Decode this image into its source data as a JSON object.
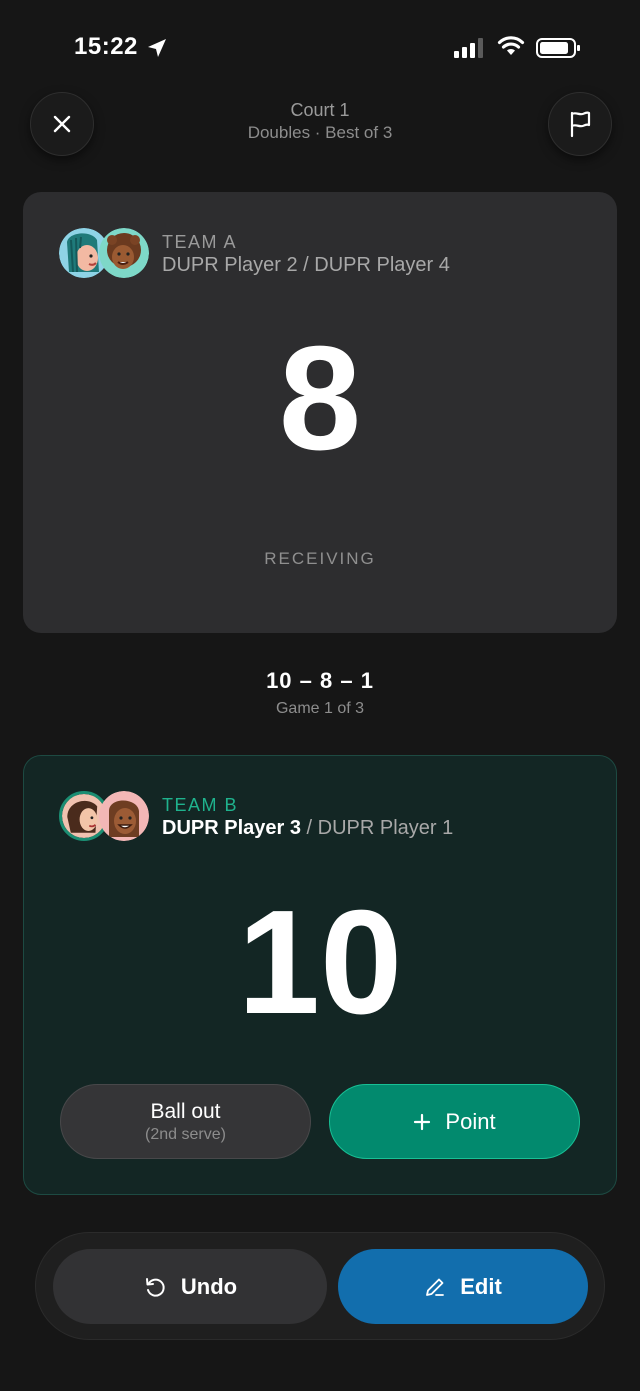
{
  "status_bar": {
    "time": "15:22"
  },
  "header": {
    "title": "Court 1",
    "subtitle": "Doubles · Best of 3"
  },
  "team_a": {
    "label": "TEAM A",
    "player_left": "DUPR Player 2",
    "separator": " / ",
    "player_right": "DUPR Player 4",
    "score": "8",
    "role": "RECEIVING"
  },
  "match": {
    "score_call": "10 – 8 – 1",
    "game_info": "Game 1 of 3"
  },
  "team_b": {
    "label": "TEAM B",
    "player_active": "DUPR Player 3",
    "separator": " / ",
    "player_other": "DUPR Player 1",
    "score": "10",
    "ball_out_label": "Ball out",
    "ball_out_sub": "(2nd serve)",
    "point_label": "Point"
  },
  "bottom": {
    "undo_label": "Undo",
    "edit_label": "Edit"
  },
  "colors": {
    "background": "#161616",
    "team_b_accent": "#1fb28d",
    "point_button": "#028a6e",
    "edit_button": "#126ead"
  },
  "icons": [
    "location-arrow-icon",
    "signal-icon",
    "wifi-icon",
    "battery-icon",
    "close-icon",
    "flag-icon",
    "plus-icon",
    "undo-icon",
    "pencil-icon"
  ]
}
